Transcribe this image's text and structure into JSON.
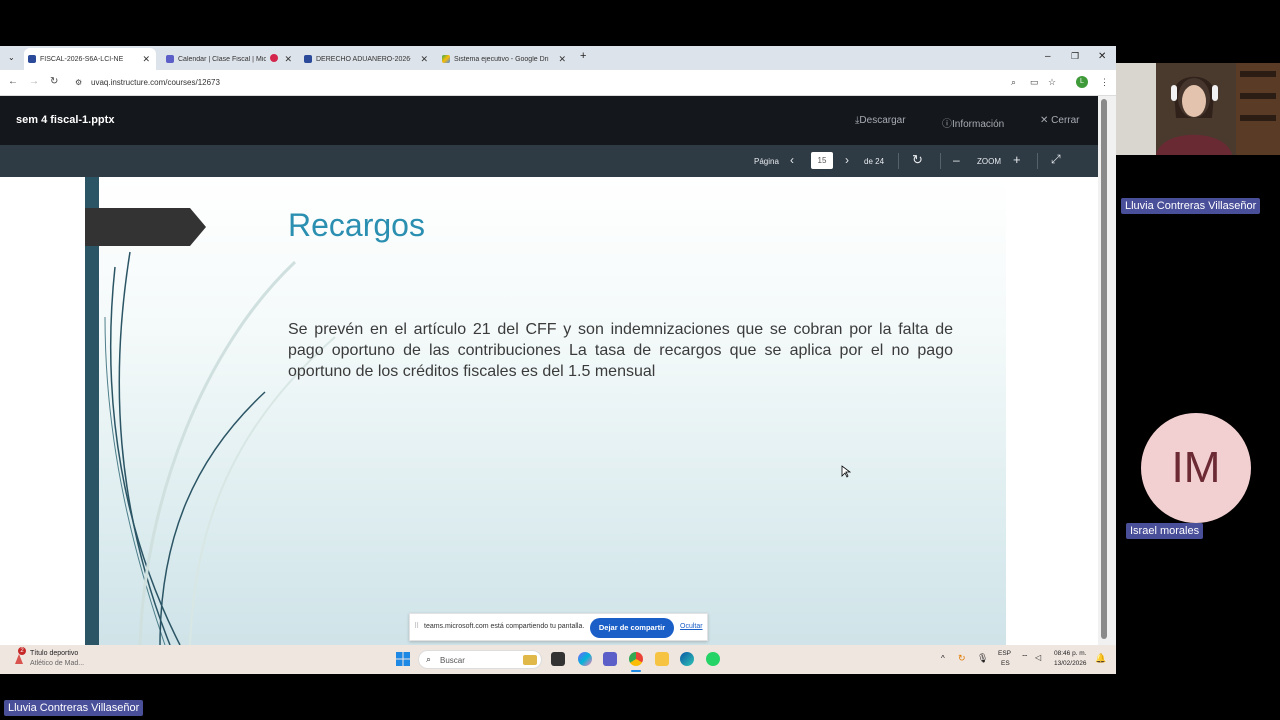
{
  "browser": {
    "tabs": [
      {
        "label": "FISCAL-2026-S6A-LCI-NE",
        "active": true
      },
      {
        "label": "Calendar | Clase Fiscal | Mic",
        "active": false
      },
      {
        "label": "DERECHO ADUANERO-2026-S",
        "active": false
      },
      {
        "label": "Sistema ejecutivo - Google Dri",
        "active": false
      }
    ],
    "url": "uvaq.instructure.com/courses/12673",
    "profile_initial": "L"
  },
  "viewer": {
    "filename": "sem 4 fiscal-1.pptx",
    "download_label": "Descargar",
    "info_label": "Información",
    "close_label": "Cerrar",
    "page_label": "Página",
    "current_page": "15",
    "of_pages": "de 24",
    "zoom_label": "ZOOM"
  },
  "slide": {
    "title": "Recargos",
    "body": "Se prevén en el artículo 21 del CFF y son indemnizaciones que se cobran por la falta de pago oportuno de las contribuciones La tasa de recargos que se aplica por el no pago oportuno de los créditos fiscales es del 1.5 mensual"
  },
  "share_notice": {
    "text": "teams.microsoft.com está compartiendo tu pantalla.",
    "stop_label": "Dejar de compartir",
    "hide_label": "Ocultar"
  },
  "taskbar": {
    "news_title": "Título deportivo",
    "news_sub": "Atlético de Mad...",
    "news_badge": "2",
    "search_placeholder": "Buscar",
    "lang_top": "ESP",
    "lang_bottom": "ES",
    "time": "08:46 p. m.",
    "date": "13/02/2026"
  },
  "teams": {
    "presenter_name": "Lluvia Contreras Villaseñor",
    "participant_initials": "IM",
    "participant_name": "Israel morales",
    "self_name": "Lluvia Contreras Villaseñor"
  },
  "colors": {
    "slide_title": "#2a8fb0",
    "stop_share_button": "#1a5fc7",
    "name_tag": "#4a4f9a",
    "avatar_bg": "#f2cfd0"
  }
}
